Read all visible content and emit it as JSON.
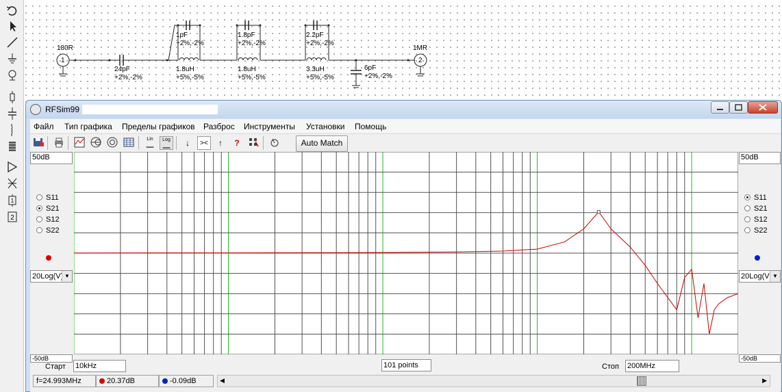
{
  "schematic": {
    "port1": {
      "id": "1",
      "impedance": "180R"
    },
    "port2": {
      "id": "2",
      "impedance": "1MR"
    },
    "components": [
      {
        "name": "series-capacitor",
        "value": "24pF",
        "tolerance": "+2%,-2%"
      },
      {
        "name": "trap1-capacitor",
        "value": "1pF",
        "tolerance": "+2%,-2%"
      },
      {
        "name": "trap1-inductor",
        "value": "1.8uH",
        "tolerance": "+5%,-5%"
      },
      {
        "name": "trap2-capacitor",
        "value": "1.8pF",
        "tolerance": "+2%,-2%"
      },
      {
        "name": "trap2-inductor",
        "value": "1.8uH",
        "tolerance": "+5%,-5%"
      },
      {
        "name": "trap3-capacitor",
        "value": "2.2pF",
        "tolerance": "+2%,-2%"
      },
      {
        "name": "trap3-inductor",
        "value": "3.3uH",
        "tolerance": "+5%,-5%"
      },
      {
        "name": "shunt-capacitor",
        "value": "6pF",
        "tolerance": "+2%,-2%"
      }
    ]
  },
  "window": {
    "title": "RFSim99 -",
    "menu": [
      "Файл",
      "Тип графика",
      "Пределы графиков",
      "Разброс",
      "Инструменты",
      "Установки",
      "Помощь"
    ],
    "toolbar": {
      "lin_label": "Lin",
      "log_label": "Log",
      "automatch_label": "Auto Match",
      "marker_left": "↓",
      "marker_center": "><",
      "marker_right": "↑",
      "help": "?"
    }
  },
  "left_panel": {
    "top_scale": "50dB",
    "bottom_scale": "-50dB",
    "params": [
      "S11",
      "S21",
      "S12",
      "S22"
    ],
    "selected": "S21",
    "trace_color": "#dd0000",
    "format": "20Log(V)"
  },
  "right_panel": {
    "top_scale": "50dB",
    "bottom_scale": "-50dB",
    "params": [
      "S11",
      "S21",
      "S12",
      "S22"
    ],
    "selected": "S11",
    "trace_color": "#0022cc",
    "format": "20Log(V)"
  },
  "sweep": {
    "start_label": "Старт",
    "start_value": "10kHz",
    "points": "101 points",
    "stop_label": "Стоп",
    "stop_value": "200MHz"
  },
  "status": {
    "frequency": "f=24.993MHz",
    "marker1": "20.37dB",
    "marker2": "-0.09dB",
    "marker1_color": "#dd0000",
    "marker2_color": "#0022cc"
  },
  "chart_data": {
    "type": "line",
    "title": "",
    "xlabel": "",
    "ylabel": "",
    "x_scale": "log",
    "xlim": [
      "10kHz",
      "200MHz"
    ],
    "ylim": [
      -50,
      50
    ],
    "grid": true,
    "series": [
      {
        "color": "#cc0000",
        "x": [
          0.01,
          0.1,
          1,
          3,
          6,
          10,
          15,
          20,
          24.993,
          30,
          40,
          50,
          60,
          80,
          90,
          100,
          110,
          120,
          130,
          140,
          150,
          170,
          200
        ],
        "y": [
          0.09,
          0.15,
          0.3,
          0.6,
          1,
          2,
          5.5,
          12,
          20.37,
          12,
          3,
          -6,
          -15,
          -28,
          -12,
          -8,
          -32,
          -15,
          -40,
          -28,
          -25,
          -22,
          -20
        ]
      }
    ]
  }
}
